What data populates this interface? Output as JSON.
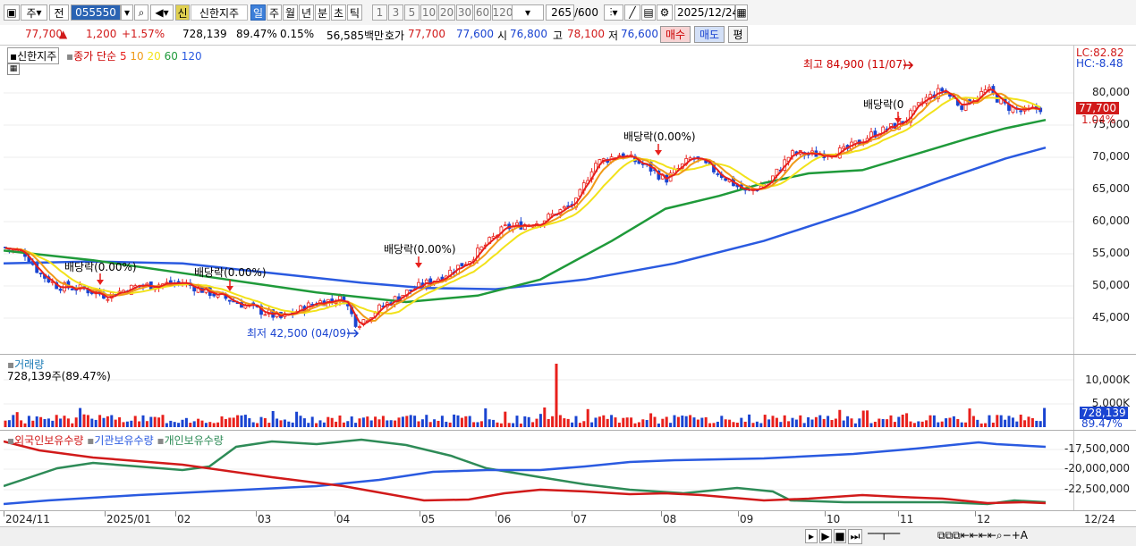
{
  "toolbar": {
    "period_short": "주",
    "prev": "전",
    "code": "055550",
    "badge": "신",
    "stock_name": "신한지주",
    "periods": [
      "일",
      "주",
      "월",
      "년",
      "분",
      "초",
      "틱"
    ],
    "numbers": [
      "1",
      "3",
      "5",
      "10",
      "20",
      "30",
      "60",
      "120"
    ],
    "count": "265",
    "count_max": "/600",
    "date": "2025/12/24"
  },
  "info": {
    "price": "77,700",
    "change": "1,200",
    "change_pct": "+1.57%",
    "volume": "728,139",
    "vol_ratio": "89.47%",
    "turnover": "0.15%",
    "amount": "56,585백만",
    "quote_label": "호가",
    "ask": "77,700",
    "bid": "77,600",
    "open_label": "시",
    "open": "76,800",
    "high_label": "고",
    "high": "78,100",
    "low_label": "저",
    "low": "76,600",
    "buy": "매수",
    "sell": "매도",
    "eval": "평"
  },
  "price_panel": {
    "name": "신한지주",
    "legend_prefix": "종가 단순",
    "ma": [
      {
        "period": "5",
        "color": "#e8201c"
      },
      {
        "period": "10",
        "color": "#f09a18"
      },
      {
        "period": "20",
        "color": "#f2e21a"
      },
      {
        "period": "60",
        "color": "#1f9a3a"
      },
      {
        "period": "120",
        "color": "#2a5ae0"
      }
    ],
    "lc": "LC:82.82",
    "hc": "HC:-8.48",
    "cur_price": "77,700",
    "cur_pct": "1.04%",
    "yticks": [
      "80,000",
      "75,000",
      "70,000",
      "65,000",
      "60,000",
      "55,000",
      "50,000",
      "45,000"
    ],
    "annotations": {
      "high": "최고 84,900 (11/07)",
      "low": "최저 42,500 (04/09)",
      "div": "배당락(0.00%)",
      "div_short": "배당락(0"
    }
  },
  "volume_panel": {
    "title": "거래량",
    "value": "728,139주(89.47%)",
    "yticks": [
      "10,000K",
      "5,000K"
    ],
    "cur": "728,139",
    "cur_pct": "89.47%"
  },
  "holder_panel": {
    "legend": [
      {
        "name": "외국인보유수량",
        "color": "#d11a1a"
      },
      {
        "name": "기관보유수량",
        "color": "#2a5ae0"
      },
      {
        "name": "개인보유수량",
        "color": "#2e8b57"
      }
    ],
    "yticks": [
      "-17,500,000",
      "-20,000,000",
      "-22,500,000"
    ]
  },
  "date_axis": [
    "2024/11",
    "2025/01",
    "02",
    "03",
    "04",
    "05",
    "06",
    "07",
    "08",
    "09",
    "10",
    "11",
    "12",
    "12/24"
  ],
  "colors": {
    "up": "#e8201c",
    "down": "#1a44d1",
    "accent": "#3d7fd9"
  }
}
